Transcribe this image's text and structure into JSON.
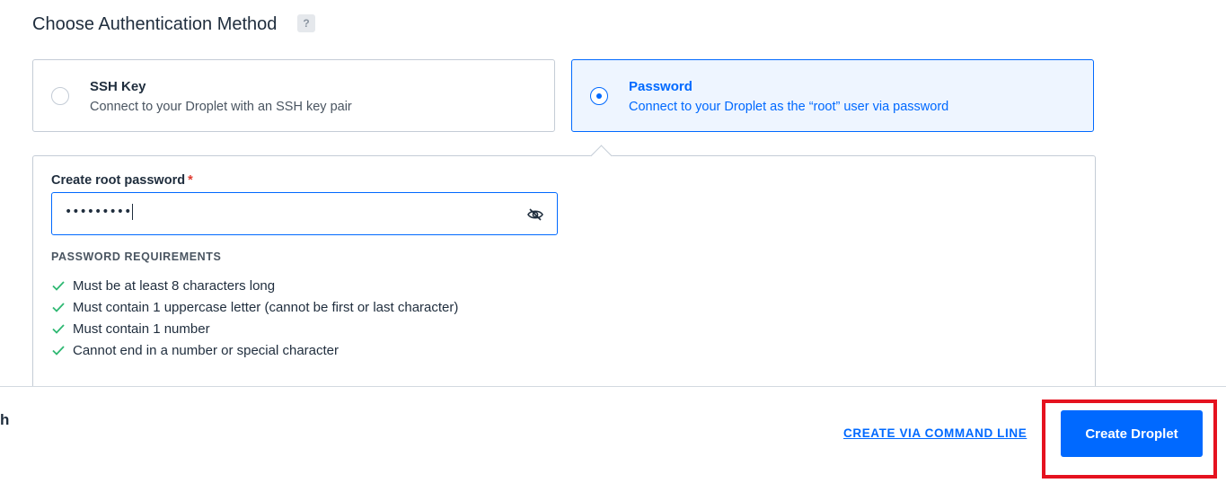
{
  "section": {
    "title": "Choose Authentication Method",
    "help_badge": "?"
  },
  "options": [
    {
      "title": "SSH Key",
      "description": "Connect to your Droplet with an SSH key pair",
      "selected": false
    },
    {
      "title": "Password",
      "description": "Connect to your Droplet as the “root” user via password",
      "selected": true
    }
  ],
  "password_field": {
    "label": "Create root password",
    "required_marker": "*",
    "masked_value": "•••••••••",
    "toggle_icon": "eye-slash-icon"
  },
  "requirements": {
    "heading": "PASSWORD REQUIREMENTS",
    "items": [
      "Must be at least 8 characters long",
      "Must contain 1 uppercase letter (cannot be first or last character)",
      "Must contain 1 number",
      "Cannot end in a number or special character"
    ],
    "check_color": "#2eb872"
  },
  "footer": {
    "edge_text": "h",
    "cli_link": "CREATE VIA COMMAND LINE",
    "create_button": "Create Droplet",
    "highlight_color": "#e5121f"
  },
  "colors": {
    "primary": "#0069ff",
    "selected_bg": "#eef5ff",
    "border": "#c4ccd6"
  }
}
